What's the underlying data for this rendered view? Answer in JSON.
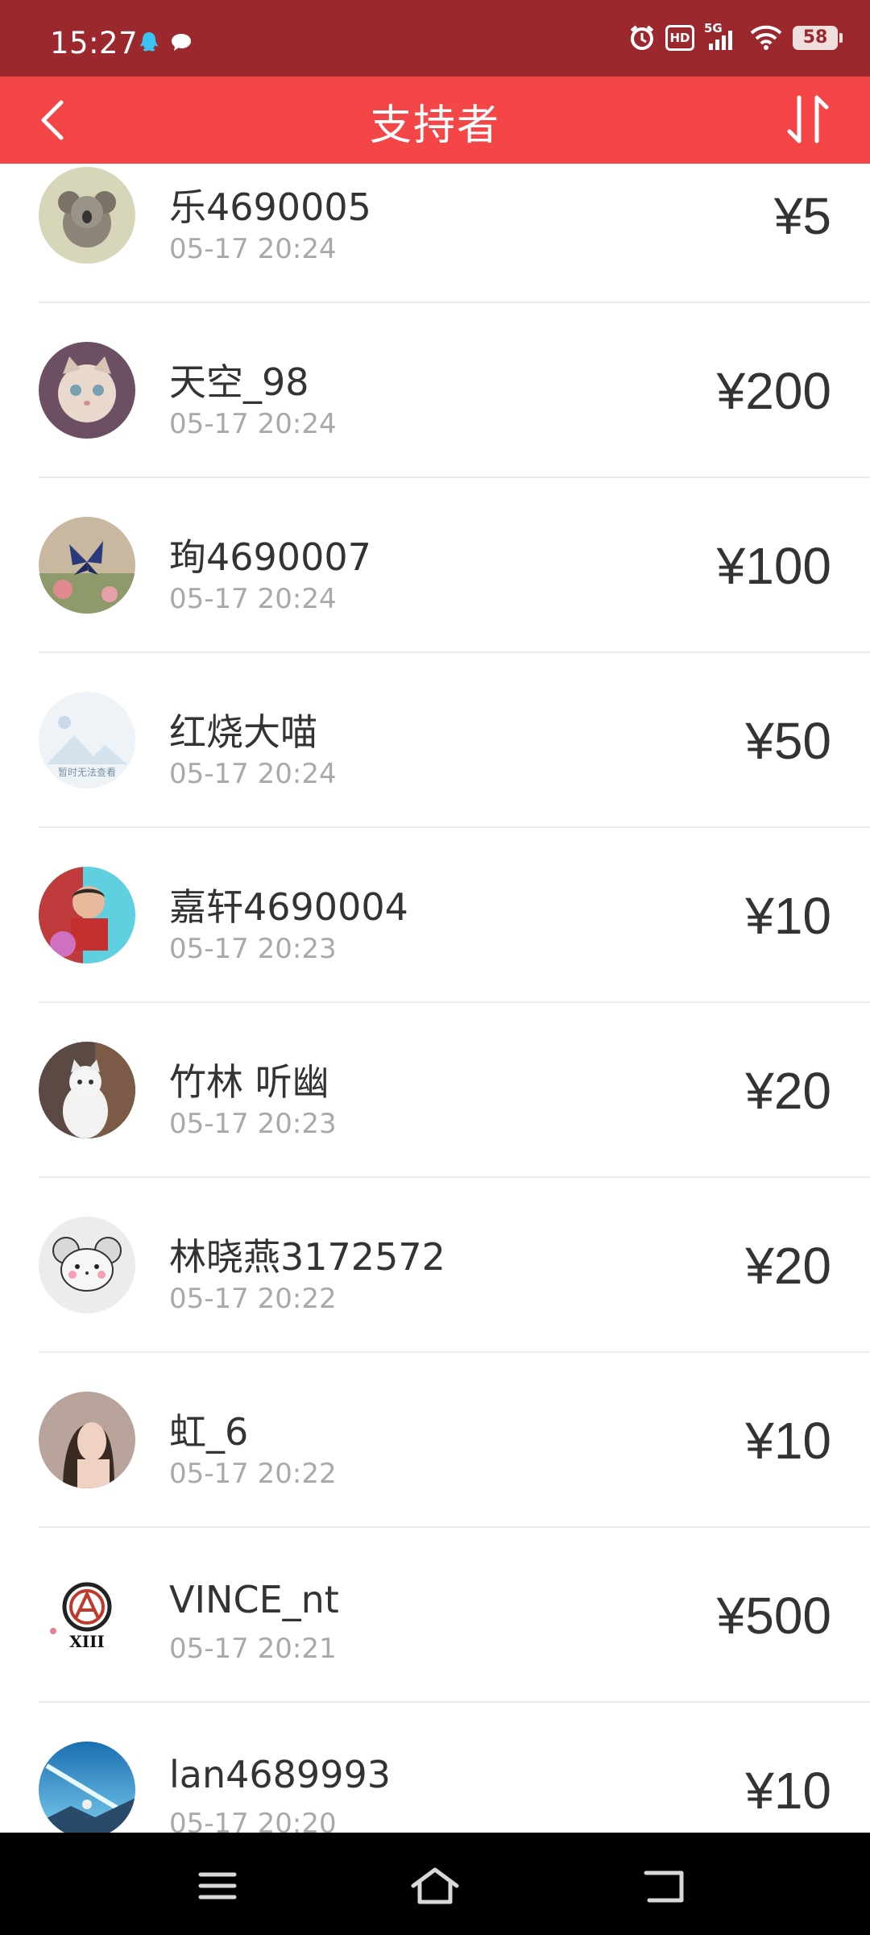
{
  "status_bar": {
    "time": "15:27",
    "network": "5G",
    "hd": "HD",
    "battery": "58"
  },
  "app_bar": {
    "title": "支持者"
  },
  "supporters": [
    {
      "name": "乐4690005",
      "time": "05-17 20:24",
      "amount": "¥5"
    },
    {
      "name": "天空_98",
      "time": "05-17 20:24",
      "amount": "¥200"
    },
    {
      "name": "珣4690007",
      "time": "05-17 20:24",
      "amount": "¥100"
    },
    {
      "name": "红烧大喵",
      "time": "05-17 20:24",
      "amount": "¥50",
      "avatar_text": "暂时无法查看"
    },
    {
      "name": "嘉轩4690004",
      "time": "05-17 20:23",
      "amount": "¥10"
    },
    {
      "name": "竹林 听幽",
      "time": "05-17 20:23",
      "amount": "¥20"
    },
    {
      "name": "林晓燕3172572",
      "time": "05-17 20:22",
      "amount": "¥20"
    },
    {
      "name": "虹_6",
      "time": "05-17 20:22",
      "amount": "¥10"
    },
    {
      "name": "VINCE_nt",
      "time": "05-17 20:21",
      "amount": "¥500",
      "avatar_text": "XIII"
    },
    {
      "name": "lan4689993",
      "time": "05-17 20:20",
      "amount": "¥10"
    }
  ],
  "colors": {
    "status_bar": "#9b282c",
    "app_bar": "#f44547",
    "name_text": "#333333",
    "time_text": "#a9a9a9"
  }
}
